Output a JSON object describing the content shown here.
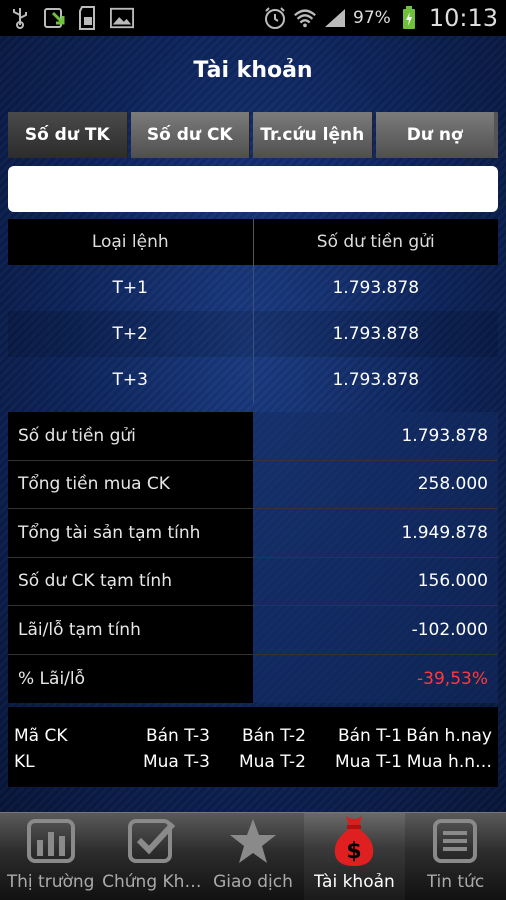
{
  "statusbar": {
    "battery": "97%",
    "time": "10:13"
  },
  "header": {
    "title": "Tài khoản"
  },
  "tabs": [
    {
      "label": "Số dư TK"
    },
    {
      "label": "Số dư CK"
    },
    {
      "label": "Tr.cứu lệnh"
    },
    {
      "label": "Dư nợ"
    }
  ],
  "search": {
    "value": "",
    "placeholder": ""
  },
  "order_table": {
    "headers": [
      "Loại lệnh",
      "Số dư tiền gửi"
    ],
    "rows": [
      [
        "T+1",
        "1.793.878"
      ],
      [
        "T+2",
        "1.793.878"
      ],
      [
        "T+3",
        "1.793.878"
      ]
    ]
  },
  "summary": [
    {
      "label": "Số dư tiền gửi",
      "value": "1.793.878"
    },
    {
      "label": "Tổng tiền mua CK",
      "value": "258.000"
    },
    {
      "label": "Tổng tài sản tạm tính",
      "value": "1.949.878"
    },
    {
      "label": "Số dư CK tạm tính",
      "value": "156.000"
    },
    {
      "label": "Lãi/lỗ tạm tính",
      "value": "-102.000"
    },
    {
      "label": "% Lãi/lỗ",
      "value": "-39,53%"
    }
  ],
  "stock_table": {
    "row1": [
      "Mã CK",
      "Bán T-3",
      "Bán T-2",
      "Bán T-1",
      "Bán h.nay"
    ],
    "row2": [
      "KL",
      "Mua T-3",
      "Mua T-2",
      "Mua T-1",
      "Mua h.n…"
    ]
  },
  "bottom_nav": [
    {
      "label": "Thị trường",
      "icon": "bar-chart-icon"
    },
    {
      "label": "Chứng Kh…",
      "icon": "checkbox-icon"
    },
    {
      "label": "Giao dịch",
      "icon": "star-icon"
    },
    {
      "label": "Tài khoản",
      "icon": "money-bag-icon"
    },
    {
      "label": "Tin tức",
      "icon": "news-icon"
    }
  ],
  "colors": {
    "negative": "#ff3a3a",
    "background": "#0c2257"
  }
}
